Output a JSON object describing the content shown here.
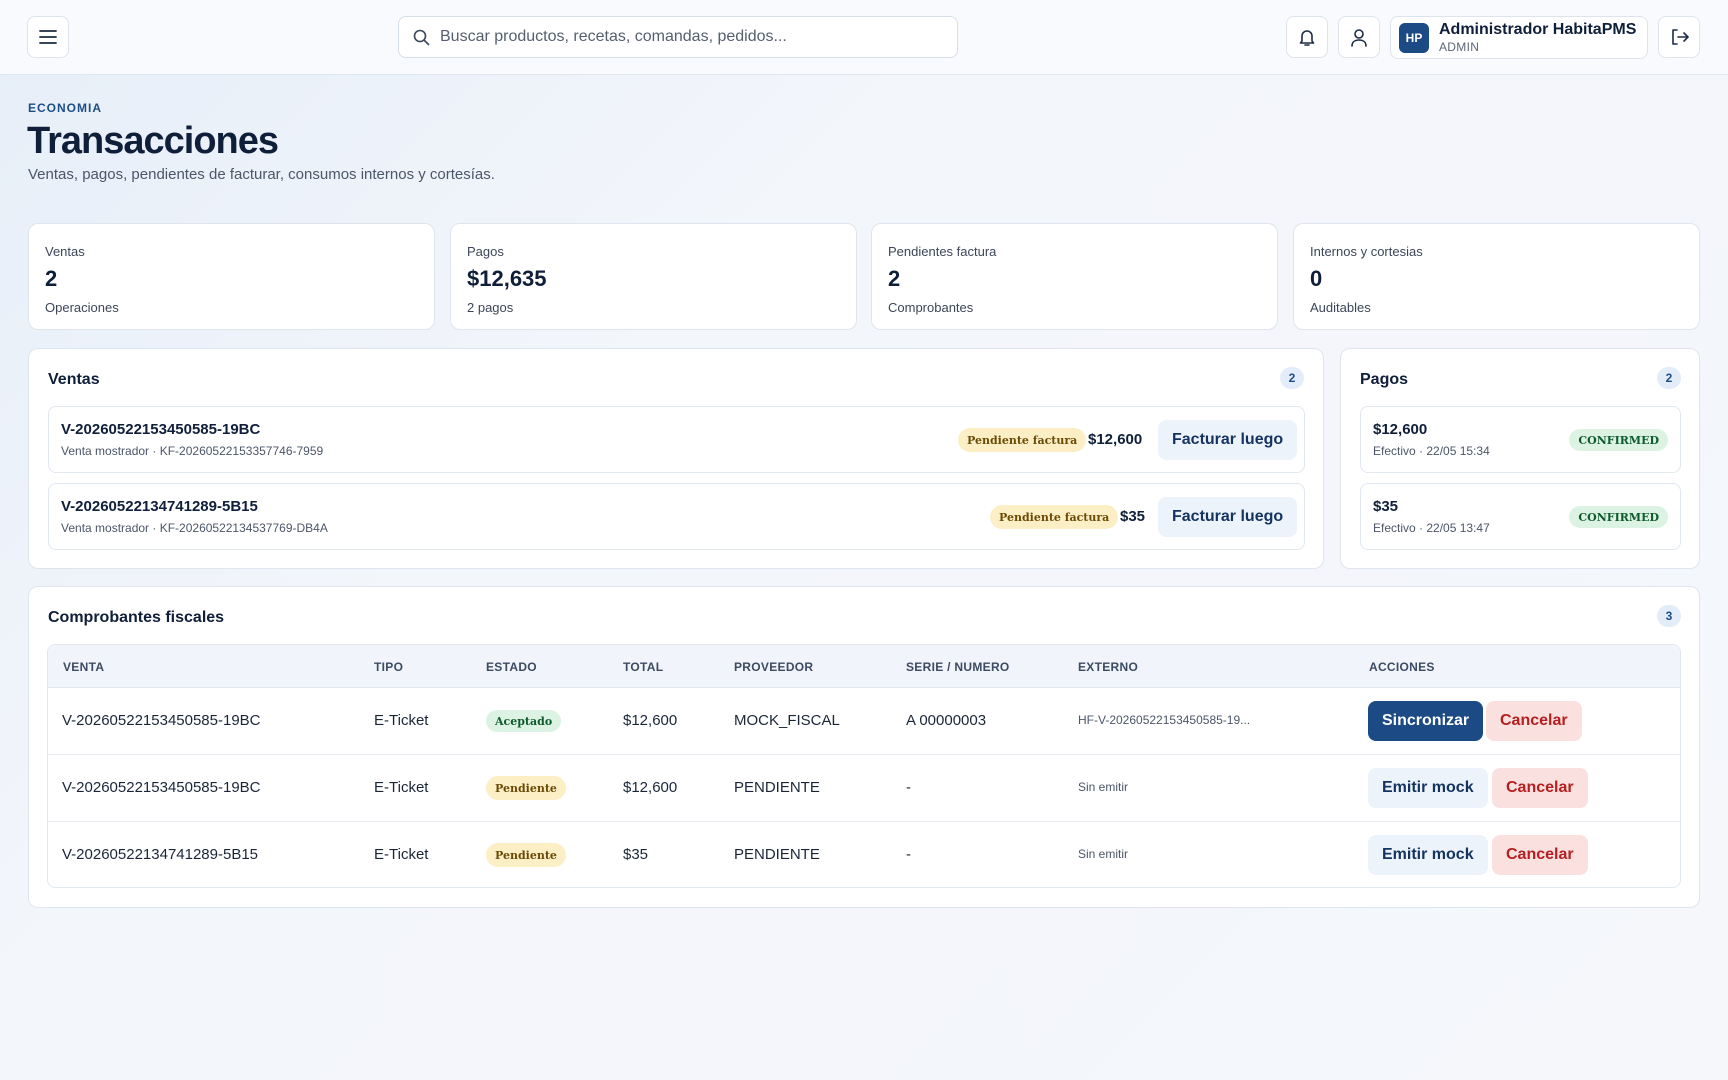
{
  "topbar": {
    "search_placeholder": "Buscar productos, recetas, comandas, pedidos...",
    "user": {
      "initials": "HP",
      "name": "Administrador HabitaPMS",
      "role": "ADMIN"
    }
  },
  "header": {
    "eyebrow": "ECONOMIA",
    "title": "Transacciones",
    "subtitle": "Ventas, pagos, pendientes de facturar, consumos internos y cortesías."
  },
  "stats": [
    {
      "label": "Ventas",
      "value": "2",
      "sub": "Operaciones"
    },
    {
      "label": "Pagos",
      "value": "$12,635",
      "sub": "2 pagos"
    },
    {
      "label": "Pendientes factura",
      "value": "2",
      "sub": "Comprobantes"
    },
    {
      "label": "Internos y cortesias",
      "value": "0",
      "sub": "Auditables"
    }
  ],
  "ventas": {
    "title": "Ventas",
    "count": "2",
    "items": [
      {
        "id": "V-20260522153450585-19BC",
        "meta": "Venta mostrador · KF-20260522153357746-7959",
        "status": "Pendiente factura",
        "amount": "$12,600",
        "action": "Facturar luego"
      },
      {
        "id": "V-20260522134741289-5B15",
        "meta": "Venta mostrador · KF-20260522134537769-DB4A",
        "status": "Pendiente factura",
        "amount": "$35",
        "action": "Facturar luego"
      }
    ]
  },
  "pagos": {
    "title": "Pagos",
    "count": "2",
    "items": [
      {
        "amount": "$12,600",
        "meta": "Efectivo · 22/05 15:34",
        "status": "CONFIRMED"
      },
      {
        "amount": "$35",
        "meta": "Efectivo · 22/05 13:47",
        "status": "CONFIRMED"
      }
    ]
  },
  "comprobantes": {
    "title": "Comprobantes fiscales",
    "count": "3",
    "columns": [
      "VENTA",
      "TIPO",
      "ESTADO",
      "TOTAL",
      "PROVEEDOR",
      "SERIE / NUMERO",
      "EXTERNO",
      "ACCIONES"
    ],
    "rows": [
      {
        "venta": "V-20260522153450585-19BC",
        "tipo": "E-Ticket",
        "estado": "Aceptado",
        "total": "$12,600",
        "proveedor": "MOCK_FISCAL",
        "serie": "A 00000003",
        "externo": "HF-V-20260522153450585-19...",
        "action1": "Sincronizar",
        "action2": "Cancelar"
      },
      {
        "venta": "V-20260522153450585-19BC",
        "tipo": "E-Ticket",
        "estado": "Pendiente",
        "total": "$12,600",
        "proveedor": "PENDIENTE",
        "serie": "-",
        "externo": "Sin emitir",
        "action1": "Emitir mock",
        "action2": "Cancelar"
      },
      {
        "venta": "V-20260522134741289-5B15",
        "tipo": "E-Ticket",
        "estado": "Pendiente",
        "total": "$35",
        "proveedor": "PENDIENTE",
        "serie": "-",
        "externo": "Sin emitir",
        "action1": "Emitir mock",
        "action2": "Cancelar"
      }
    ]
  }
}
